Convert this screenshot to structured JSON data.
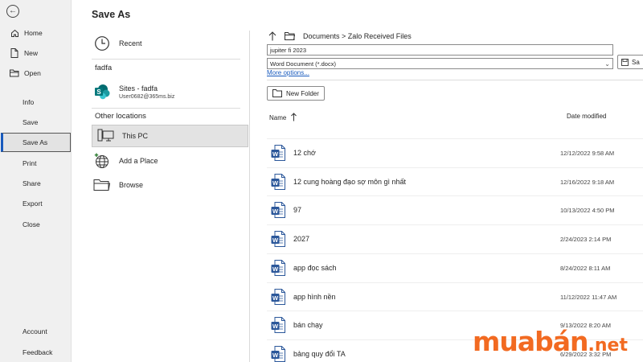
{
  "nav": {
    "items": [
      {
        "label": "Home",
        "icon": "home-icon"
      },
      {
        "label": "New",
        "icon": "new-document-icon"
      },
      {
        "label": "Open",
        "icon": "open-folder-icon"
      },
      {
        "label": "Info"
      },
      {
        "label": "Save"
      },
      {
        "label": "Save As",
        "selected": true
      },
      {
        "label": "Print"
      },
      {
        "label": "Share"
      },
      {
        "label": "Export"
      },
      {
        "label": "Close"
      },
      {
        "label": "Account"
      },
      {
        "label": "Feedback"
      }
    ]
  },
  "page_title": "Save As",
  "locations": {
    "recent_label": "Recent",
    "account_header": "fadfa",
    "site_label": "Sites - fadfa",
    "site_sub": "User0682@365ms.biz",
    "other_header": "Other locations",
    "this_pc": "This PC",
    "add_place": "Add a Place",
    "browse": "Browse"
  },
  "save_panel": {
    "path": "Documents > Zalo Received Files",
    "filename": "jupiter fi 2023",
    "filetype": "Word Document (*.docx)",
    "save_label": "Sa",
    "more_options": "More options...",
    "new_folder": "New Folder",
    "col_name": "Name",
    "col_date": "Date modified"
  },
  "files": [
    {
      "name": "12 chớ",
      "date": "12/12/2022 9:58 AM"
    },
    {
      "name": "12 cung hoàng đạo sợ môn gì nhất",
      "date": "12/16/2022 9:18 AM"
    },
    {
      "name": "97",
      "date": "10/13/2022 4:50 PM"
    },
    {
      "name": "2027",
      "date": "2/24/2023 2:14 PM"
    },
    {
      "name": "app đọc sách",
      "date": "8/24/2022 8:11 AM"
    },
    {
      "name": "app hình nền",
      "date": "11/12/2022 11:47 AM"
    },
    {
      "name": "bán chạy",
      "date": "9/13/2022 8:20 AM"
    },
    {
      "name": "bảng quy đổi TA",
      "date": "6/29/2022 3:32 PM"
    }
  ],
  "watermark": {
    "main": "muabán",
    "suffix": ".net"
  },
  "colors": {
    "accent": "#185abd",
    "word_blue": "#2b579a",
    "watermark": "#f26a21",
    "nav_bg": "#f0f0f0"
  }
}
